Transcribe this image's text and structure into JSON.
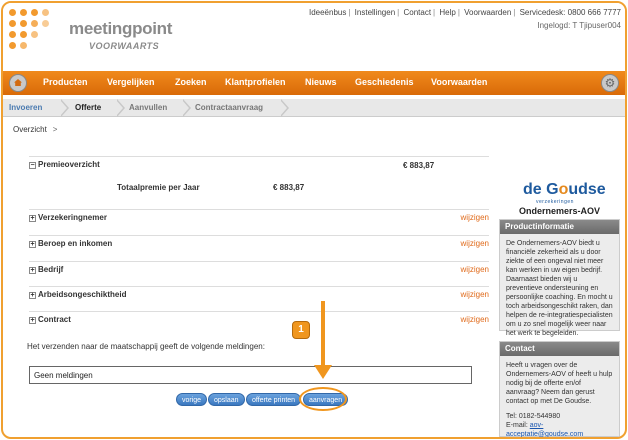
{
  "header": {
    "logo_title": "meetingpoint",
    "logo_subtitle": "VOORWAARTS",
    "top_links": [
      "Ideeënbus",
      "Instellingen",
      "Contact",
      "Help",
      "Voorwaarden"
    ],
    "servicedesk": "Servicedesk: 0800 666 7777",
    "logged_in": "Ingelogd: T Tjipuser004"
  },
  "nav": {
    "items": [
      "Producten",
      "Vergelijken",
      "Zoeken",
      "Klantprofielen",
      "Nieuws",
      "Geschiedenis",
      "Voorwaarden"
    ]
  },
  "steps": [
    "Invoeren",
    "Offerte",
    "Aanvullen",
    "Contractaanvraag"
  ],
  "breadcrumb": {
    "label": "Overzicht",
    "arrow": ">"
  },
  "premie": {
    "title": "Premieoverzicht",
    "amount": "€ 883,87",
    "total_label": "Totaalpremie per Jaar",
    "total_amount": "€ 883,87"
  },
  "sections": [
    {
      "title": "Verzekeringnemer",
      "action": "wijzigen"
    },
    {
      "title": "Beroep en inkomen",
      "action": "wijzigen"
    },
    {
      "title": "Bedrijf",
      "action": "wijzigen"
    },
    {
      "title": "Arbeidsongeschiktheid",
      "action": "wijzigen"
    },
    {
      "title": "Contract",
      "action": "wijzigen"
    }
  ],
  "messages": {
    "notice": "Het verzenden naar de maatschappij geeft de volgende meldingen:",
    "value": "Geen meldingen"
  },
  "buttons": {
    "vorige": "vorige",
    "opslaan": "opslaan",
    "offerte_printen": "offerte printen",
    "aanvragen": "aanvragen"
  },
  "annotation": {
    "step_number": "1"
  },
  "brand": {
    "name_de": "de ",
    "name_g": "G",
    "name_o": "o",
    "name_rest": "udse",
    "tagline": "verzekeringen",
    "product": "Ondernemers-AOV"
  },
  "productinfo": {
    "title": "Productinformatie",
    "text": "De Ondernemers-AOV biedt u financiële zekerheid als u door ziekte of een ongeval niet meer kan werken in uw eigen bedrijf. Daarnaast bieden wij u preventieve ondersteuning en persoonlijke coaching. En mocht u toch arbeidsongeschikt raken, dan helpen de re-integratiespecialisten om u zo snel mogelijk weer naar het werk te begeleiden."
  },
  "contact": {
    "title": "Contact",
    "text": "Heeft u vragen over de Ondernemers-AOV of heeft u hulp nodig bij de offerte en/of aanvraag? Neem dan gerust contact op met De Goudse.",
    "phone": "Tel: 0182-544980",
    "email_label": "E-mail: ",
    "email": "aov-acceptatie@goudse.com"
  },
  "colors": {
    "accent": "#f08a1c",
    "link": "#e06a1a",
    "button": "#3b78c0",
    "annotation": "#f0961e"
  }
}
